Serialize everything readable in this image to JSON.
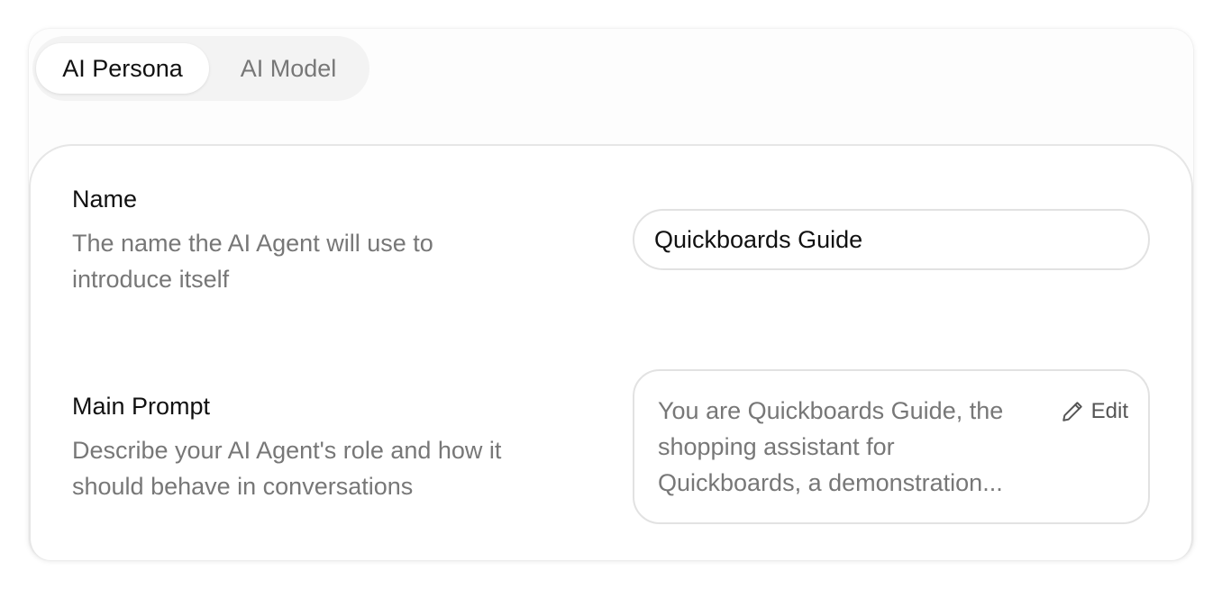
{
  "tabs": [
    {
      "label": "AI Persona",
      "active": true
    },
    {
      "label": "AI Model",
      "active": false
    }
  ],
  "name_field": {
    "label": "Name",
    "description": "The name the AI Agent will use to introduce itself",
    "value": "Quickboards Guide"
  },
  "prompt_field": {
    "label": "Main Prompt",
    "description": "Describe your AI Agent's role and how it should behave in conversations",
    "preview": "You are Quickboards Guide, the shopping assistant for Quickboards, a demonstration...",
    "edit_label": "Edit",
    "edit_icon": "pencil-icon"
  },
  "colors": {
    "text_primary": "#111111",
    "text_muted": "#777777",
    "border": "#e2e2e2",
    "tab_track": "#f3f3f3"
  }
}
